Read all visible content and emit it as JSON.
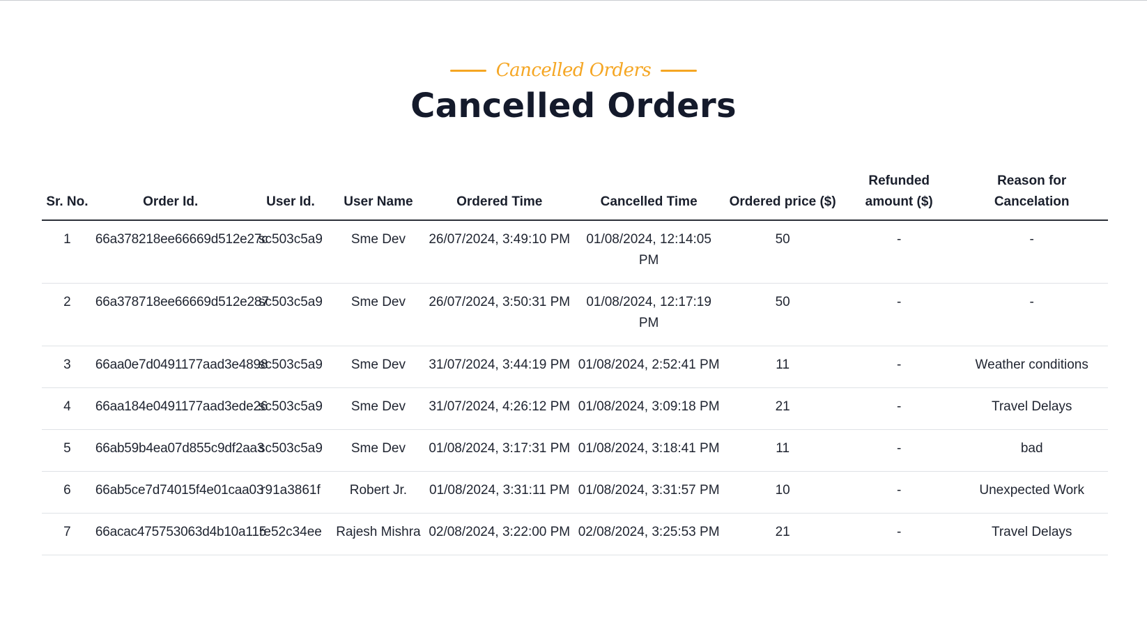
{
  "header": {
    "subtitle": "Cancelled Orders",
    "title": "Cancelled Orders",
    "accent_color": "#f5a623"
  },
  "table": {
    "columns": [
      "Sr. No.",
      "Order Id.",
      "User Id.",
      "User Name",
      "Ordered Time",
      "Cancelled Time",
      "Ordered price ($)",
      "Refunded amount ($)",
      "Reason for Cancelation"
    ],
    "rows": [
      [
        "1",
        "66a378218ee66669d512e27c",
        "sc503c5a9",
        "Sme Dev",
        "26/07/2024, 3:49:10 PM",
        "01/08/2024, 12:14:05 PM",
        "50",
        "-",
        "-"
      ],
      [
        "2",
        "66a378718ee66669d512e287",
        "sc503c5a9",
        "Sme Dev",
        "26/07/2024, 3:50:31 PM",
        "01/08/2024, 12:17:19 PM",
        "50",
        "-",
        "-"
      ],
      [
        "3",
        "66aa0e7d0491177aad3e4898",
        "sc503c5a9",
        "Sme Dev",
        "31/07/2024, 3:44:19 PM",
        "01/08/2024, 2:52:41 PM",
        "11",
        "-",
        "Weather conditions"
      ],
      [
        "4",
        "66aa184e0491177aad3ede26",
        "sc503c5a9",
        "Sme Dev",
        "31/07/2024, 4:26:12 PM",
        "01/08/2024, 3:09:18 PM",
        "21",
        "-",
        "Travel Delays"
      ],
      [
        "5",
        "66ab59b4ea07d855c9df2aa3",
        "sc503c5a9",
        "Sme Dev",
        "01/08/2024, 3:17:31 PM",
        "01/08/2024, 3:18:41 PM",
        "11",
        "-",
        "bad"
      ],
      [
        "6",
        "66ab5ce7d74015f4e01caa03",
        "r91a3861f",
        "Robert Jr.",
        "01/08/2024, 3:31:11 PM",
        "01/08/2024, 3:31:57 PM",
        "10",
        "-",
        "Unexpected Work"
      ],
      [
        "7",
        "66acac475753063d4b10a115",
        "re52c34ee",
        "Rajesh Mishra",
        "02/08/2024, 3:22:00 PM",
        "02/08/2024, 3:25:53 PM",
        "21",
        "-",
        "Travel Delays"
      ]
    ]
  }
}
